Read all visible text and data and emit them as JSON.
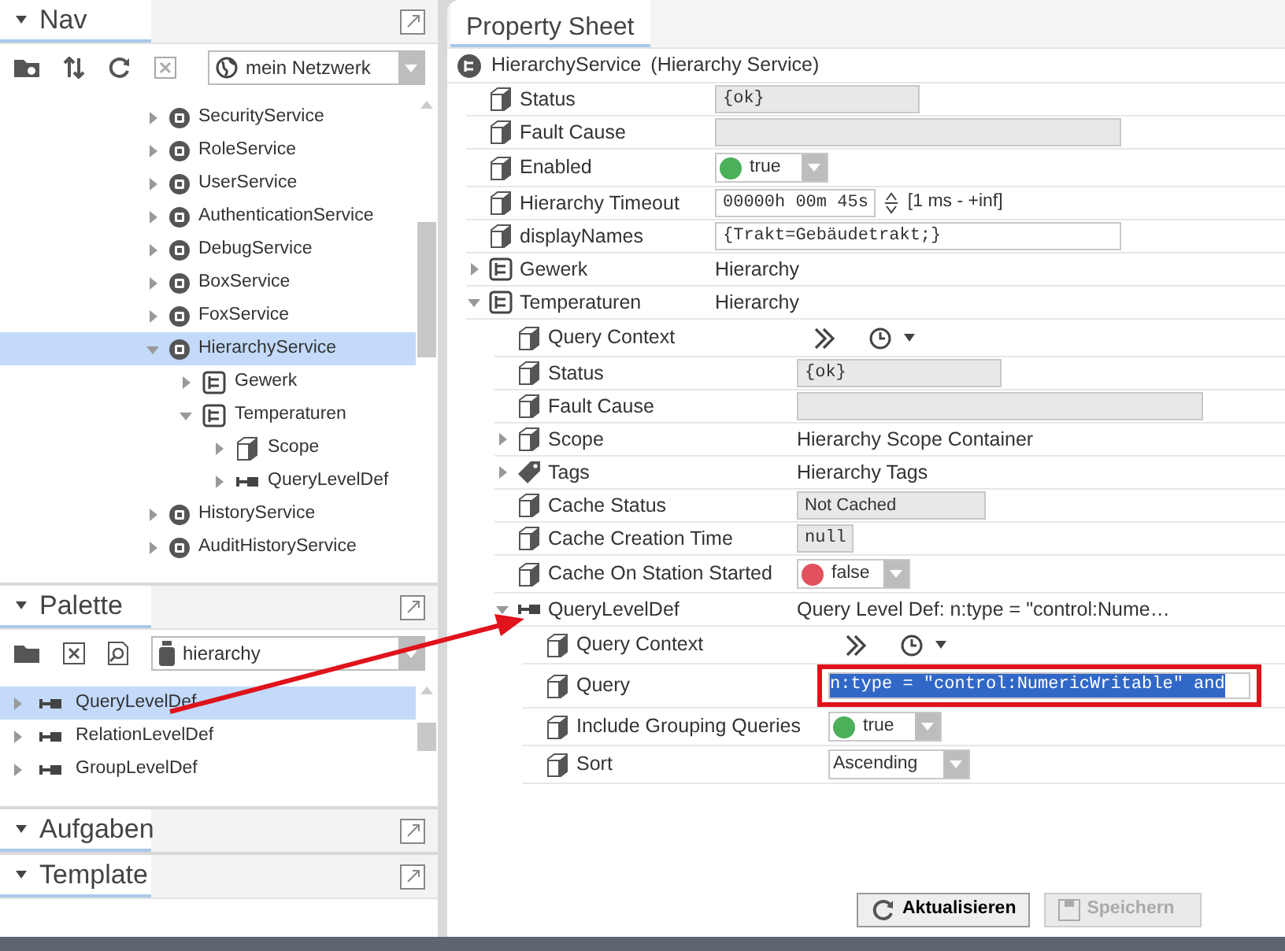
{
  "nav": {
    "title": "Nav",
    "network": "mein Netzwerk",
    "tree": [
      {
        "label": "SecurityService",
        "kind": "service",
        "expanded": false,
        "selected": false
      },
      {
        "label": "RoleService",
        "kind": "service",
        "expanded": false,
        "selected": false
      },
      {
        "label": "UserService",
        "kind": "service",
        "expanded": false,
        "selected": false
      },
      {
        "label": "AuthenticationService",
        "kind": "service",
        "expanded": false,
        "selected": false
      },
      {
        "label": "DebugService",
        "kind": "service",
        "expanded": false,
        "selected": false
      },
      {
        "label": "BoxService",
        "kind": "service",
        "expanded": false,
        "selected": false
      },
      {
        "label": "FoxService",
        "kind": "service",
        "expanded": false,
        "selected": false
      },
      {
        "label": "HierarchyService",
        "kind": "service",
        "expanded": true,
        "selected": true,
        "children": [
          {
            "label": "Gewerk",
            "kind": "hierarchy",
            "expanded": false,
            "selected": false
          },
          {
            "label": "Temperaturen",
            "kind": "hierarchy",
            "expanded": true,
            "selected": false,
            "children": [
              {
                "label": "Scope",
                "kind": "scope",
                "expanded": false,
                "selected": false
              },
              {
                "label": "QueryLevelDef",
                "kind": "leveldef",
                "expanded": false,
                "selected": false
              }
            ]
          }
        ]
      },
      {
        "label": "HistoryService",
        "kind": "service",
        "expanded": false,
        "selected": false
      },
      {
        "label": "AuditHistoryService",
        "kind": "service",
        "expanded": false,
        "selected": false
      }
    ]
  },
  "palette": {
    "title": "Palette",
    "module": "hierarchy",
    "items": [
      {
        "label": "QueryLevelDef",
        "selected": true
      },
      {
        "label": "RelationLevelDef",
        "selected": false
      },
      {
        "label": "GroupLevelDef",
        "selected": false
      }
    ]
  },
  "panels": [
    {
      "title": "Aufgaben"
    },
    {
      "title": "Template"
    }
  ],
  "property_sheet": {
    "tab": {
      "label": "Property Sheet",
      "selected": true
    },
    "component": {
      "name": "HierarchyService",
      "type": "(Hierarchy Service)"
    },
    "properties": [
      {
        "label": "Status",
        "kind": "readonly",
        "value": "{ok}"
      },
      {
        "label": "Fault Cause",
        "kind": "readonly"
      },
      {
        "label": "Enabled",
        "kind": "boolean",
        "value": "true",
        "on": true
      },
      {
        "label": "Hierarchy Timeout",
        "kind": "duration",
        "value": "00000h 00m 45s",
        "range": "[1 ms - +inf]"
      },
      {
        "label": "displayNames",
        "kind": "text",
        "value": "{Trakt=Gebäudetrakt;}"
      },
      {
        "label": "Gewerk",
        "kind": "hierarchy",
        "value": "Hierarchy",
        "expanded": false
      },
      {
        "label": "Temperaturen",
        "kind": "hierarchy",
        "value": "Hierarchy",
        "expanded": true,
        "children": [
          {
            "label": "Query Context",
            "kind": "context"
          },
          {
            "label": "Status",
            "kind": "readonly",
            "value": "{ok}"
          },
          {
            "label": "Fault Cause",
            "kind": "readonly"
          },
          {
            "label": "Scope",
            "kind": "scope",
            "value": "Hierarchy Scope Container",
            "expanded": false
          },
          {
            "label": "Tags",
            "kind": "tags",
            "value": "Hierarchy Tags",
            "expanded": false
          },
          {
            "label": "Cache Status",
            "kind": "readonly",
            "value": "Not Cached"
          },
          {
            "label": "Cache Creation Time",
            "kind": "readonly",
            "value": "null"
          },
          {
            "label": "Cache On Station Started",
            "kind": "boolean",
            "value": "false",
            "on": false
          },
          {
            "label": "QueryLevelDef",
            "kind": "leveldef",
            "value": "Query Level Def: n:type = \"control:Nume…",
            "expanded": true,
            "children": [
              {
                "label": "Query Context",
                "kind": "context"
              },
              {
                "label": "Query",
                "kind": "query",
                "value": "n:type = \"control:NumericWritable\" and",
                "highlighted": true,
                "text_selected": true
              },
              {
                "label": "Include Grouping Queries",
                "kind": "boolean",
                "value": "true",
                "on": true
              },
              {
                "label": "Sort",
                "kind": "select",
                "value": "Ascending"
              }
            ]
          }
        ]
      }
    ]
  },
  "buttons": [
    {
      "label": "Aktualisieren",
      "kind": "refresh",
      "disabled": false
    },
    {
      "label": "Speichern",
      "kind": "save",
      "disabled": true
    }
  ],
  "annotation": {
    "arrow": true
  }
}
